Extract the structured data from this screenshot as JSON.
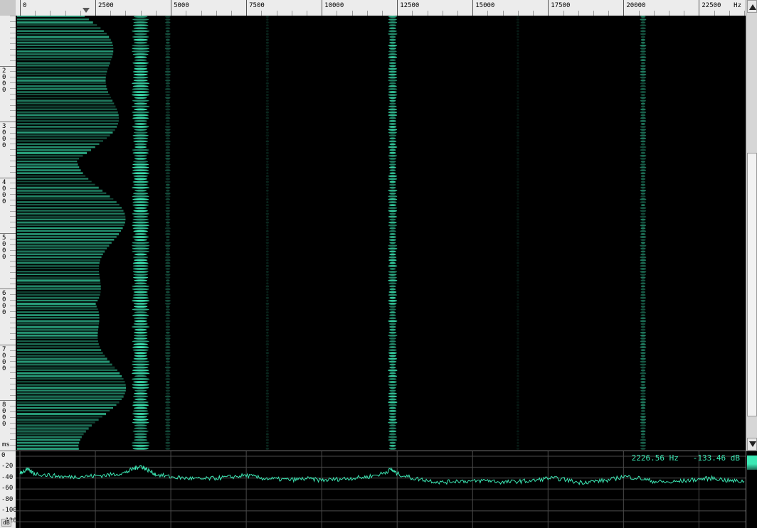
{
  "colors": {
    "accent": "#3ce8b4",
    "background": "#000000",
    "grid": "#4a4a4a",
    "ruler_bg": "#ececec"
  },
  "freq_axis": {
    "unit": "Hz",
    "labels": [
      "0",
      "2500",
      "5000",
      "7500",
      "10000",
      "12500",
      "15000",
      "17500",
      "20000",
      "22500"
    ],
    "min": 0,
    "max": 24000,
    "playhead_hz": 2200
  },
  "time_axis": {
    "unit": "ms",
    "labels": [
      "2000",
      "3000",
      "4000",
      "5000",
      "6000",
      "7000",
      "8000"
    ],
    "min_ms": 1100,
    "max_ms": 8900
  },
  "spectrogram": {
    "note": "",
    "bands_hz": [
      {
        "center": 4000,
        "width": 500,
        "strength": 1.0
      },
      {
        "center": 12350,
        "width": 260,
        "strength": 0.9
      },
      {
        "center": 20650,
        "width": 180,
        "strength": 0.55
      },
      {
        "center": 8200,
        "width": 90,
        "strength": 0.18
      },
      {
        "center": 16500,
        "width": 80,
        "strength": 0.12
      },
      {
        "center": 4900,
        "width": 160,
        "strength": 0.35
      }
    ]
  },
  "scrollbar": {
    "position_fraction": 0.33,
    "thumb_fraction": 0.62
  },
  "db_axis": {
    "unit": "dB",
    "labels": [
      "0",
      "-20",
      "-40",
      "-60",
      "-80",
      "-100",
      "-120"
    ],
    "min": -130,
    "max": 0
  },
  "readout": {
    "frequency": "2226.56 Hz",
    "level": "-133.46 dB"
  },
  "chart_data": {
    "type": "line",
    "title": "",
    "xlabel": "Hz",
    "ylabel": "dB",
    "xlim": [
      0,
      24000
    ],
    "ylim": [
      -130,
      0
    ],
    "grid": true,
    "x": [
      0,
      250,
      500,
      1000,
      1500,
      2000,
      2500,
      3000,
      3500,
      3800,
      4000,
      4200,
      4500,
      5000,
      5500,
      6000,
      6500,
      7000,
      7500,
      8000,
      8500,
      9000,
      9500,
      10000,
      10500,
      11000,
      11500,
      12000,
      12300,
      12500,
      13000,
      13500,
      14000,
      14500,
      15000,
      15500,
      16000,
      16500,
      17000,
      17500,
      18000,
      18500,
      19000,
      19500,
      20000,
      20500,
      21000,
      21500,
      22000,
      22500,
      23000,
      23500,
      24000
    ],
    "series": [
      {
        "values": [
          -30,
          -25,
          -32,
          -35,
          -38,
          -37,
          -36,
          -34,
          -30,
          -22,
          -18,
          -24,
          -33,
          -38,
          -40,
          -42,
          -40,
          -38,
          -35,
          -40,
          -42,
          -43,
          -41,
          -44,
          -42,
          -40,
          -38,
          -32,
          -24,
          -32,
          -40,
          -44,
          -48,
          -45,
          -46,
          -44,
          -48,
          -46,
          -45,
          -40,
          -42,
          -48,
          -46,
          -44,
          -37,
          -40,
          -46,
          -48,
          -45,
          -42,
          -40,
          -45,
          -46
        ]
      }
    ]
  }
}
